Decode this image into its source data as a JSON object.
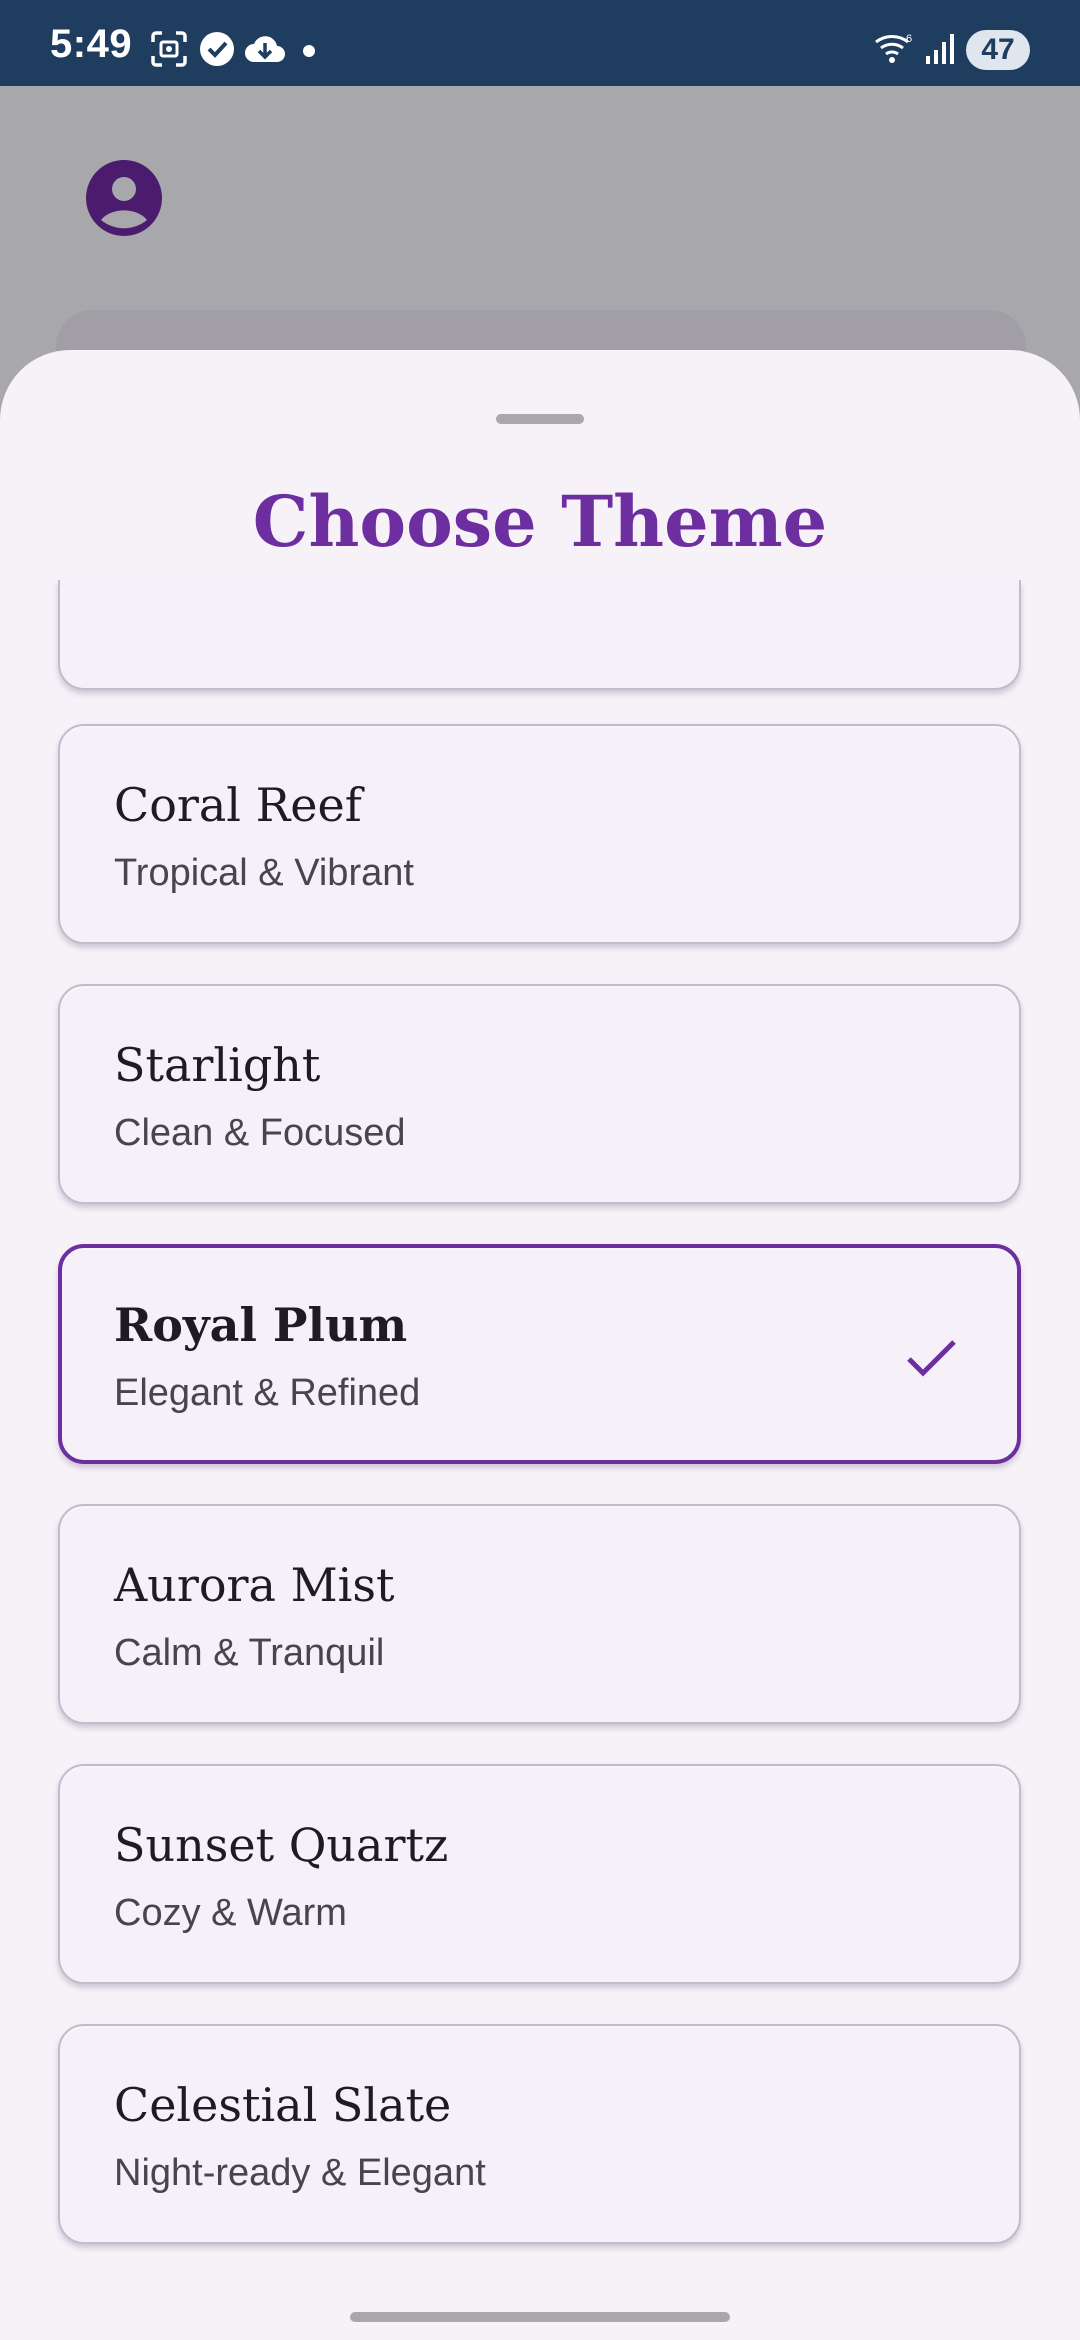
{
  "status_bar": {
    "time": "5:49",
    "battery": "47",
    "icons": [
      "screenshot-icon",
      "check-circle-icon",
      "cloud-download-icon",
      "dot-icon",
      "wifi-icon",
      "signal-icon",
      "battery-icon"
    ]
  },
  "sheet": {
    "title": "Choose Theme",
    "themes": [
      {
        "name": "Coral Reef",
        "description": "Tropical & Vibrant",
        "selected": false
      },
      {
        "name": "Starlight",
        "description": "Clean & Focused",
        "selected": false
      },
      {
        "name": "Royal Plum",
        "description": "Elegant & Refined",
        "selected": true
      },
      {
        "name": "Aurora Mist",
        "description": "Calm & Tranquil",
        "selected": false
      },
      {
        "name": "Sunset Quartz",
        "description": "Cozy & Warm",
        "selected": false
      },
      {
        "name": "Celestial Slate",
        "description": "Night-ready & Elegant",
        "selected": false
      }
    ]
  },
  "colors": {
    "accent": "#6d2ea0",
    "status_bar": "#1f3d5e",
    "sheet_background": "#f7f2f8",
    "scrim": "#a8a7ab"
  }
}
